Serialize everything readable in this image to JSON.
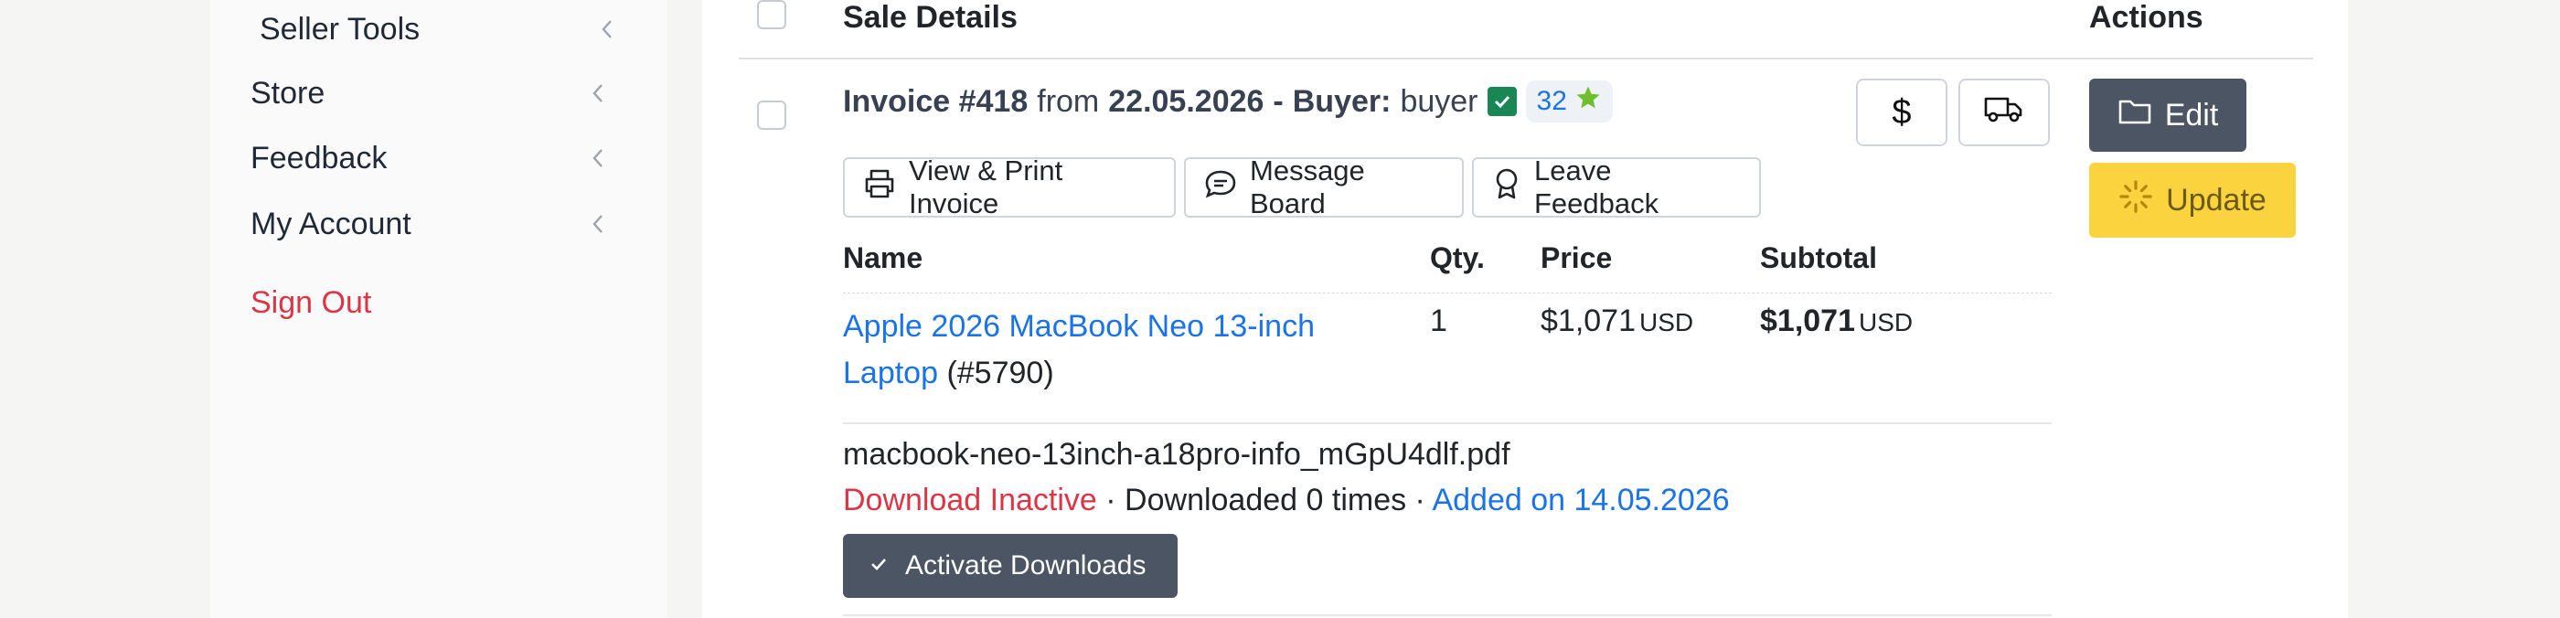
{
  "sidebar": {
    "items": [
      {
        "label": "Seller Tools",
        "icon": "chevron-left-icon"
      },
      {
        "label": "Store",
        "icon": "chevron-left-icon"
      },
      {
        "label": "Feedback",
        "icon": "chevron-left-icon"
      },
      {
        "label": "My Account",
        "icon": "chevron-left-icon"
      }
    ],
    "sign_out": "Sign Out"
  },
  "table": {
    "header_sale_details": "Sale Details",
    "header_actions": "Actions"
  },
  "invoice": {
    "label": "Invoice #418",
    "from_word": "from",
    "date": "22.05.2026",
    "dash": "-",
    "buyer_label": "Buyer:",
    "buyer_name": "buyer",
    "feedback_score": "32",
    "colors": {
      "verified": "#198754",
      "star": "#6fbf2c",
      "link": "#1a73e8",
      "danger": "#dc3545"
    }
  },
  "buttons": {
    "dollar": "$",
    "print_invoice": "View & Print Invoice",
    "message_board": "Message Board",
    "leave_feedback": "Leave Feedback",
    "edit": "Edit",
    "update": "Update",
    "activate_downloads": "Activate Downloads"
  },
  "items_table": {
    "columns": [
      "Name",
      "Qty.",
      "Price",
      "Subtotal"
    ],
    "rows": [
      {
        "name_link": "Apple 2026 MacBook Neo 13-inch Laptop",
        "item_id": "(#5790)",
        "qty": "1",
        "price": "$1,071",
        "price_currency": "USD",
        "subtotal": "$1,071",
        "subtotal_currency": "USD"
      }
    ]
  },
  "download": {
    "file_name": "macbook-neo-13inch-a18pro-info_mGpU4dlf.pdf",
    "status": "Download Inactive",
    "sep1": " · ",
    "count_text": "Downloaded 0 times",
    "sep2": " · ",
    "added_text": "Added on 14.05.2026"
  }
}
